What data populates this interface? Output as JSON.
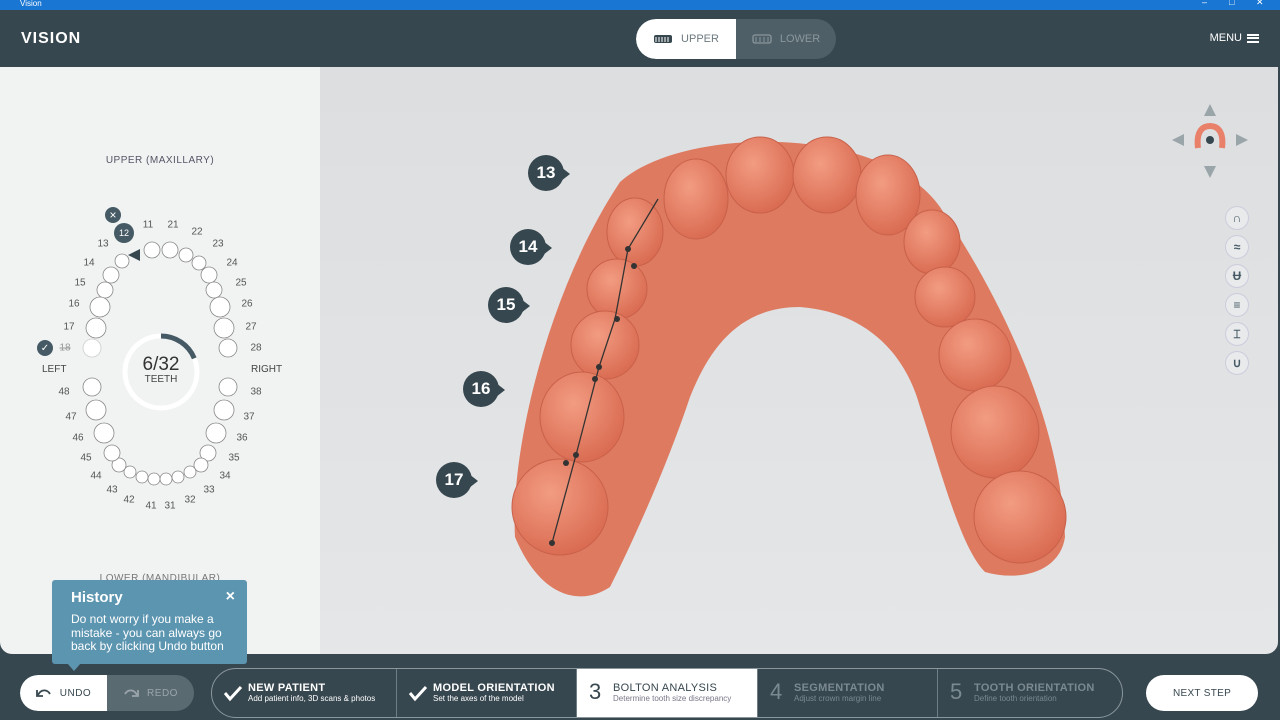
{
  "window": {
    "title": "Vision"
  },
  "header": {
    "logo": "VISION",
    "jaw_upper": "UPPER",
    "jaw_lower": "LOWER",
    "menu": "MENU"
  },
  "left_panel": {
    "upper_label": "UPPER (MAXILLARY)",
    "lower_label": "LOWER (MANDIBULAR)",
    "left_label": "LEFT",
    "right_label": "RIGHT",
    "counter": "6/32",
    "counter_sub": "TEETH",
    "selected_tooth": "12",
    "tooth_numbers": {
      "t11": "11",
      "t21": "21",
      "t22": "22",
      "t23": "23",
      "t24": "24",
      "t25": "25",
      "t26": "26",
      "t27": "27",
      "t28": "28",
      "t13": "13",
      "t14": "14",
      "t15": "15",
      "t16": "16",
      "t17": "17",
      "t18": "18",
      "t38": "38",
      "t37": "37",
      "t36": "36",
      "t35": "35",
      "t34": "34",
      "t33": "33",
      "t32": "32",
      "t31": "31",
      "t48": "48",
      "t47": "47",
      "t46": "46",
      "t45": "45",
      "t44": "44",
      "t43": "43",
      "t42": "42",
      "t41": "41"
    },
    "progress": 0.1875
  },
  "viewport": {
    "markers": [
      "13",
      "14",
      "15",
      "16",
      "17"
    ]
  },
  "history": {
    "title": "History",
    "text": "Do not worry if you make a mistake - you can always go back by clicking Undo button"
  },
  "bottom": {
    "undo": "UNDO",
    "redo": "REDO",
    "steps": [
      {
        "title": "NEW PATIENT",
        "sub": "Add patient info, 3D scans & photos"
      },
      {
        "number": "3",
        "title": "BOLTON ANALYSIS",
        "sub": "Determine tooth size discrepancy"
      },
      {
        "number": "4",
        "title": "SEGMENTATION",
        "sub": "Adjust crown margin line"
      },
      {
        "number": "5",
        "title": "TOOTH ORIENTATION",
        "sub": "Define tooth orientation"
      },
      {
        "title": "MODEL ORIENTATION",
        "sub": "Set the axes of the model"
      }
    ],
    "next_step": "NEXT STEP"
  },
  "colors": {
    "header": "#37474f",
    "panel": "#f1f2f2",
    "model": "#e07a62",
    "history": "#5c95b0",
    "titlebar": "#1976d2"
  }
}
